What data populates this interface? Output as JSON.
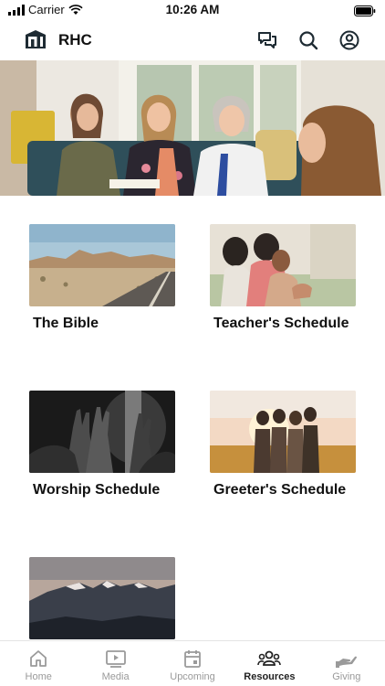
{
  "status_bar": {
    "carrier": "Carrier",
    "time": "10:26 AM"
  },
  "header": {
    "app_name": "RHC"
  },
  "cards": [
    {
      "title": "The Bible"
    },
    {
      "title": "Teacher's Schedule"
    },
    {
      "title": "Worship Schedule"
    },
    {
      "title": "Greeter's Schedule"
    },
    {
      "title": ""
    }
  ],
  "tabbar": {
    "items": [
      {
        "label": "Home",
        "icon": "home-icon"
      },
      {
        "label": "Media",
        "icon": "media-icon"
      },
      {
        "label": "Upcoming",
        "icon": "calendar-icon"
      },
      {
        "label": "Resources",
        "icon": "people-icon",
        "active": true
      },
      {
        "label": "Giving",
        "icon": "giving-icon"
      }
    ]
  },
  "colors": {
    "accent": "#1e2b33",
    "tab_inactive": "#9a9a9a"
  }
}
